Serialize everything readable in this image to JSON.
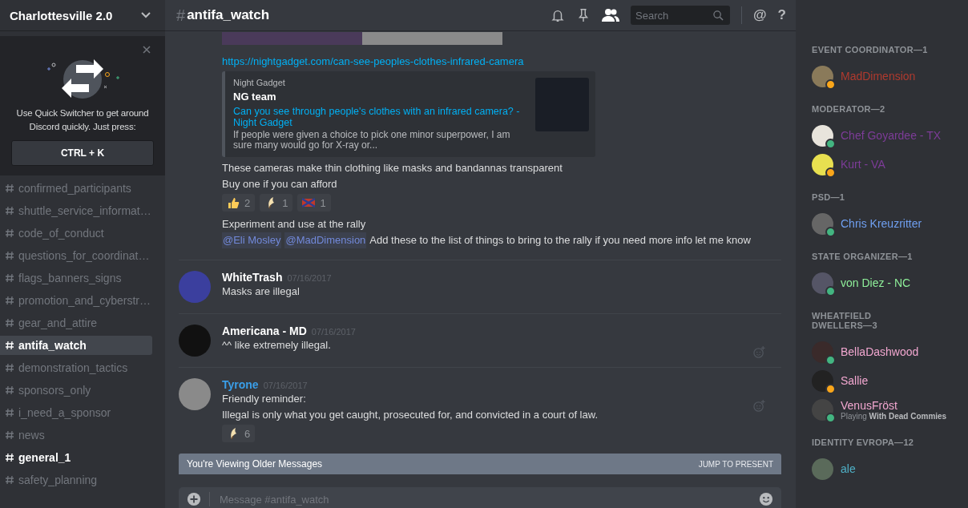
{
  "server": {
    "name": "Charlottesville 2.0"
  },
  "quick_switcher": {
    "text": "Use Quick Switcher to get around Discord quickly. Just press:",
    "shortcut": "CTRL + K"
  },
  "channels": [
    {
      "name": "confirmed_participants",
      "selected": false,
      "unread": false
    },
    {
      "name": "shuttle_service_informat…",
      "selected": false,
      "unread": false
    },
    {
      "name": "code_of_conduct",
      "selected": false,
      "unread": false
    },
    {
      "name": "questions_for_coordinat…",
      "selected": false,
      "unread": false
    },
    {
      "name": "flags_banners_signs",
      "selected": false,
      "unread": false
    },
    {
      "name": "promotion_and_cyberstr…",
      "selected": false,
      "unread": false
    },
    {
      "name": "gear_and_attire",
      "selected": false,
      "unread": false
    },
    {
      "name": "antifa_watch",
      "selected": true,
      "unread": false
    },
    {
      "name": "demonstration_tactics",
      "selected": false,
      "unread": false
    },
    {
      "name": "sponsors_only",
      "selected": false,
      "unread": false
    },
    {
      "name": "i_need_a_sponsor",
      "selected": false,
      "unread": false
    },
    {
      "name": "news",
      "selected": false,
      "unread": false
    },
    {
      "name": "general_1",
      "selected": false,
      "unread": true
    },
    {
      "name": "safety_planning",
      "selected": false,
      "unread": false
    }
  ],
  "header": {
    "hash": "#",
    "channel": "antifa_watch",
    "search_placeholder": "Search",
    "at": "@",
    "help": "?"
  },
  "messages": [
    {
      "kind": "continued",
      "parts": [
        {
          "kind": "image"
        },
        {
          "kind": "link",
          "text": "https://nightgadget.com/can-see-peoples-clothes-infrared-camera"
        },
        {
          "kind": "embed",
          "provider": "Night Gadget",
          "author": "NG team",
          "title": "Can you see through people's clothes with an infrared camera?  - Night Gadget",
          "description": "If people were given a choice to pick one minor superpower, I am sure many would go for X-ray or..."
        },
        {
          "kind": "text",
          "text": "These cameras make thin clothing like masks and bandannas transparent"
        },
        {
          "kind": "text",
          "text": "Buy one if you can afford"
        },
        {
          "kind": "reactions",
          "items": [
            {
              "kind": "thumbs",
              "count": "2"
            },
            {
              "kind": "crescent",
              "count": "1"
            },
            {
              "kind": "flag",
              "count": "1"
            }
          ]
        },
        {
          "kind": "text",
          "text": "Experiment and use at the rally"
        },
        {
          "kind": "mentions",
          "mentions": [
            "@Eli Mosley",
            "@MadDimension"
          ],
          "text": "Add these to the list of things to bring to the rally if you need more info let me know"
        }
      ]
    },
    {
      "kind": "new",
      "author": "WhiteTrash",
      "color": "#ffffff",
      "timestamp": "07/16/2017",
      "parts": [
        {
          "kind": "text",
          "text": "Masks are illegal"
        }
      ]
    },
    {
      "kind": "new",
      "author": "Americana - MD",
      "color": "#ffffff",
      "timestamp": "07/16/2017",
      "add_reaction": true,
      "parts": [
        {
          "kind": "text",
          "text": "^^ like extremely illegal."
        }
      ]
    },
    {
      "kind": "new",
      "author": "Tyrone",
      "color": "#3a9ee8",
      "timestamp": "07/16/2017",
      "add_reaction": true,
      "parts": [
        {
          "kind": "text",
          "text": "Friendly reminder:"
        },
        {
          "kind": "text",
          "text": "Illegal is only what you get caught, prosecuted for, and convicted in a court of law."
        },
        {
          "kind": "reactions",
          "items": [
            {
              "kind": "crescent",
              "count": "6"
            }
          ]
        }
      ]
    }
  ],
  "older_bar": {
    "text": "You're Viewing Older Messages",
    "action": "JUMP TO PRESENT"
  },
  "composer": {
    "placeholder": "Message #antifa_watch"
  },
  "member_groups": [
    {
      "title": "EVENT COORDINATOR—1",
      "members": [
        {
          "name": "MadDimension",
          "color": "#b03a2e",
          "idle": true
        }
      ]
    },
    {
      "title": "MODERATOR—2",
      "members": [
        {
          "name": "Chef Goyardee - TX",
          "color": "#7d3c98",
          "idle": false
        },
        {
          "name": "Kurt - VA",
          "color": "#7d3c98",
          "idle": true
        }
      ]
    },
    {
      "title": "PSD—1",
      "members": [
        {
          "name": "Chris Kreuzritter",
          "color": "#6f9ff0",
          "idle": false
        }
      ]
    },
    {
      "title": "STATE ORGANIZER—1",
      "members": [
        {
          "name": "von Diez - NC",
          "color": "#8ff09a",
          "idle": false
        }
      ]
    },
    {
      "title": "WHEATFIELD DWELLERS—3",
      "members": [
        {
          "name": "BellaDashwood",
          "color": "#f2a7d0",
          "idle": false
        },
        {
          "name": "Sallie",
          "color": "#f2a7d0",
          "idle": true
        },
        {
          "name": "VenusFröst",
          "color": "#f2a7d0",
          "idle": false,
          "activity": "Playing **With Dead Commies**"
        }
      ]
    },
    {
      "title": "IDENTITY EVROPA—12",
      "members": [
        {
          "name": "ale",
          "color": "#4fb0c6"
        }
      ]
    }
  ]
}
